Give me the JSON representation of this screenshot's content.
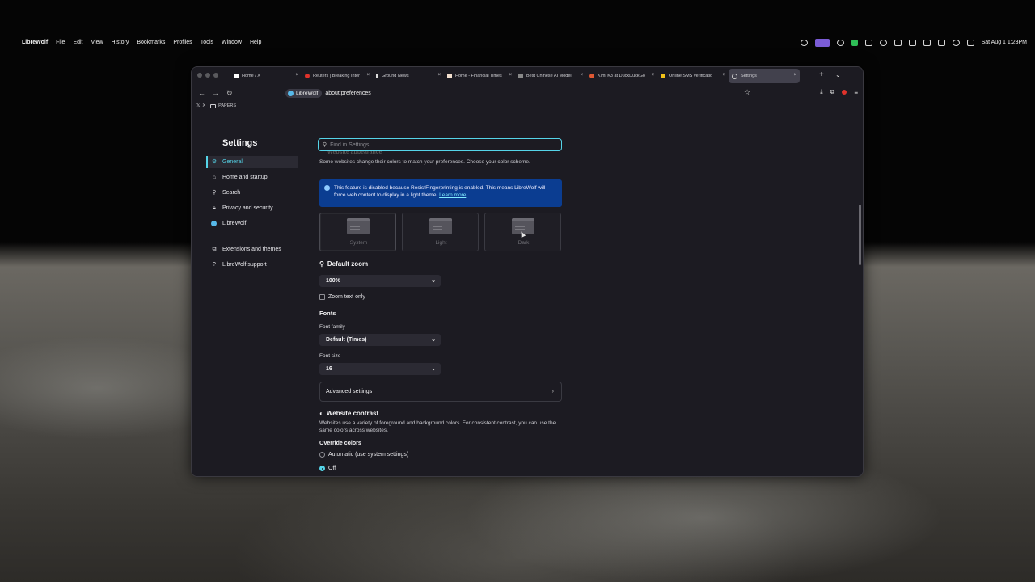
{
  "menubar": {
    "app_name": "LibreWolf",
    "items": [
      "File",
      "Edit",
      "View",
      "History",
      "Bookmarks",
      "Profiles",
      "Tools",
      "Window",
      "Help"
    ],
    "clock": "Sat Aug 1  1:23PM"
  },
  "tabs": [
    {
      "title": "Home / X",
      "favicon": "x-icon",
      "color": "#ffffff"
    },
    {
      "title": "Reuters | Breaking Inter",
      "favicon": "reuters-icon",
      "color": "#e0322b"
    },
    {
      "title": "Ground News",
      "favicon": "ground-news-icon",
      "color": "#dddddd"
    },
    {
      "title": "Home - Financial Times",
      "favicon": "ft-icon",
      "color": "#f2dfce"
    },
    {
      "title": "Best Chinese AI Model:",
      "favicon": "generic-icon",
      "color": "#888888"
    },
    {
      "title": "Kimi K3 at DuckDuckGo",
      "favicon": "duckduckgo-icon",
      "color": "#de5833"
    },
    {
      "title": "Online SMS verificatio",
      "favicon": "sms-icon",
      "color": "#f2c218"
    },
    {
      "title": "Settings",
      "favicon": "gear-icon",
      "color": "#cccccc",
      "active": true
    }
  ],
  "navbar": {
    "identity_chip": "LibreWolf",
    "url": "about:preferences"
  },
  "bookmarks": [
    {
      "label": "X",
      "icon": "x-icon"
    },
    {
      "label": "PAPERS",
      "icon": "folder-icon"
    }
  ],
  "sidebar": {
    "title": "Settings",
    "items": [
      {
        "label": "General",
        "icon": "gear-icon",
        "active": true
      },
      {
        "label": "Home and startup",
        "icon": "home-icon"
      },
      {
        "label": "Search",
        "icon": "search-icon"
      },
      {
        "label": "Privacy and security",
        "icon": "lock-icon"
      },
      {
        "label": "LibreWolf",
        "icon": "librewolf-icon"
      },
      {
        "label": "Extensions and themes",
        "icon": "puzzle-icon"
      },
      {
        "label": "LibreWolf support",
        "icon": "help-icon"
      }
    ]
  },
  "main": {
    "search_placeholder": "Find in Settings",
    "appearance": {
      "heading": "Website appearance",
      "description": "Some websites change their colors to match your preferences. Choose your color scheme.",
      "notice": "This feature is disabled because ResistFingerprinting is enabled. This means LibreWolf will force web content to display in a light theme.",
      "notice_link": "Learn more",
      "options": [
        "System",
        "Light",
        "Dark"
      ],
      "selected": "System"
    },
    "zoom": {
      "heading": "Default zoom",
      "value": "100%",
      "text_only_label": "Zoom text only",
      "text_only_checked": false
    },
    "fonts": {
      "heading": "Fonts",
      "family_label": "Font family",
      "family_value": "Default (Times)",
      "size_label": "Font size",
      "size_value": "16",
      "advanced_label": "Advanced settings"
    },
    "contrast": {
      "heading": "Website contrast",
      "description": "Websites use a variety of foreground and background colors. For consistent contrast, you can use the same colors across websites.",
      "override_label": "Override colors",
      "options": [
        "Automatic (use system settings)",
        "Off"
      ],
      "selected": "Off"
    }
  },
  "colors": {
    "accent": "#55d4e8",
    "notice_bg": "#0b3d91",
    "window_bg": "#1c1b22"
  }
}
